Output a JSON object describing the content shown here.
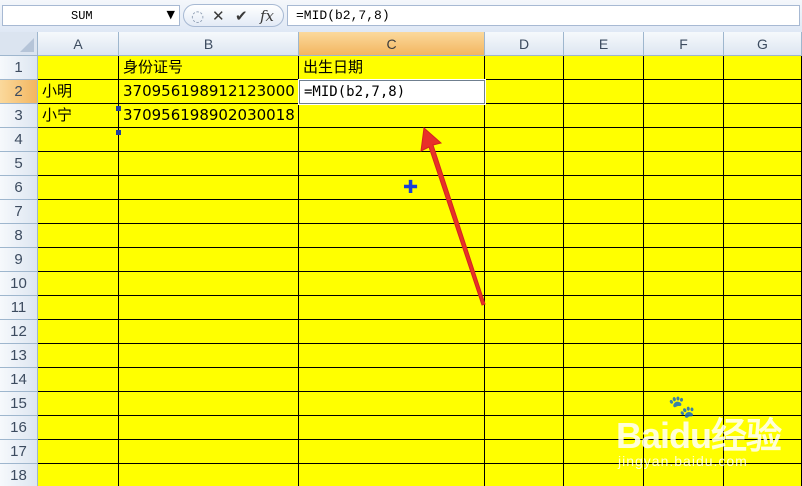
{
  "formula_bar": {
    "name_box": "SUM",
    "formula": "=MID(b2,7,8)",
    "icons": [
      "scroll-handle-icon",
      "cancel-icon",
      "enter-icon",
      "function-icon"
    ]
  },
  "columns": [
    "A",
    "B",
    "C",
    "D",
    "E",
    "F",
    "G"
  ],
  "active_column": "C",
  "rows": [
    "1",
    "2",
    "3",
    "4",
    "5",
    "6",
    "7",
    "8",
    "9",
    "10",
    "11",
    "12",
    "13",
    "14",
    "15",
    "16",
    "17",
    "18"
  ],
  "active_row": "2",
  "cells": {
    "B1": "身份证号",
    "C1": "出生日期",
    "A2": "小明",
    "B2": "370956198912123000",
    "C2": "=MID(b2,7,8)",
    "A3": "小宁",
    "B3": "370956198902030018"
  },
  "colors": {
    "cell_fill": "#ffff00",
    "arrow": "#e8302a",
    "header_active": "#f3b660"
  },
  "watermark": {
    "logo": "Baidu经验",
    "sub": "jingyan.baidu.com"
  }
}
